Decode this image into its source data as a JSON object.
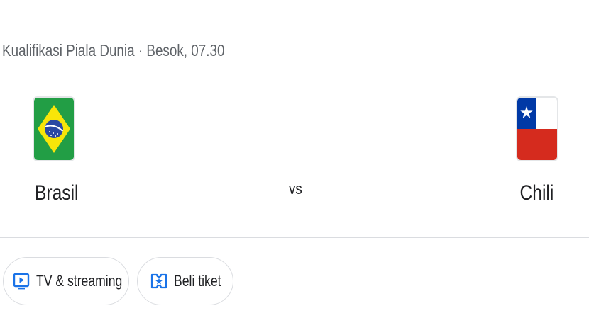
{
  "match": {
    "header": "Kualifikasi Piala Dunia · Besok, 07.30",
    "vs_label": "vs",
    "home_team": {
      "name": "Brasil",
      "flag": "brazil-flag"
    },
    "away_team": {
      "name": "Chili",
      "flag": "chile-flag"
    }
  },
  "actions": {
    "tv_label": "TV & streaming",
    "tv_icon": "tv-play-icon",
    "ticket_label": "Beli tiket",
    "ticket_icon": "ticket-star-icon"
  },
  "colors": {
    "accent": "#1a73e8",
    "muted_text": "#5f6368",
    "divider": "#dadce0"
  }
}
